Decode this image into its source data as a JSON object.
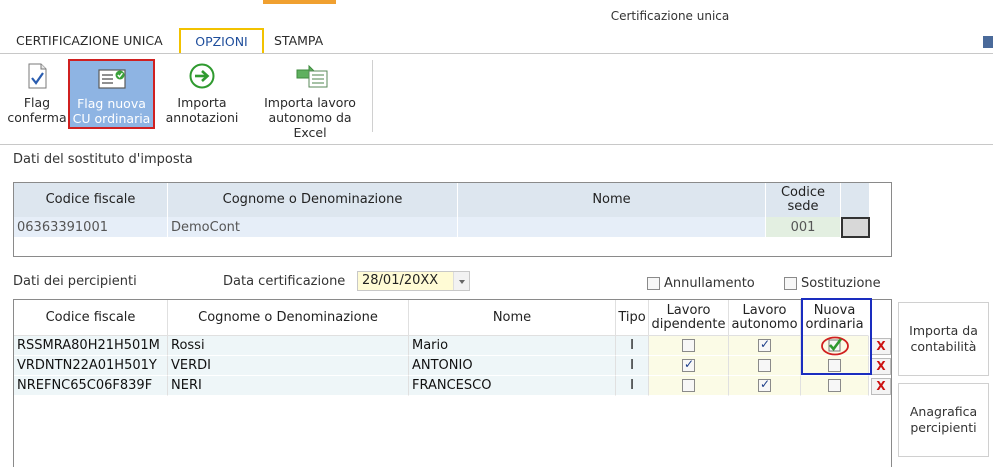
{
  "window": {
    "title": "Certificazione unica"
  },
  "ribbon": {
    "tabs": [
      {
        "label": "CERTIFICAZIONE UNICA"
      },
      {
        "label": "OPZIONI"
      },
      {
        "label": "STAMPA"
      }
    ],
    "buttons": [
      {
        "label": "Flag\nconferma",
        "icon": "document-check-icon"
      },
      {
        "label": "Flag nuova\nCU ordinaria",
        "icon": "card-check-icon"
      },
      {
        "label": "Importa\nannotazioni",
        "icon": "arrow-right-circle-icon"
      },
      {
        "label": "Importa lavoro\nautonomo da Excel",
        "icon": "excel-import-icon"
      }
    ]
  },
  "sostituto": {
    "section_label": "Dati del sostituto d'imposta",
    "columns": [
      "Codice fiscale",
      "Cognome o Denominazione",
      "Nome",
      "Codice\nsede"
    ],
    "row": {
      "codice_fiscale": "06363391001",
      "denominazione": "DemoCont",
      "nome": "",
      "codice_sede": "001"
    }
  },
  "percipienti": {
    "section_label": "Dati dei percipienti",
    "date_label": "Data certificazione",
    "date_value": "28/01/20XX",
    "annullamento_label": "Annullamento",
    "sostituzione_label": "Sostituzione",
    "columns": [
      "Codice fiscale",
      "Cognome o Denominazione",
      "Nome",
      "Tipo",
      "Lavoro\ndipendente",
      "Lavoro\nautonomo",
      "Nuova\nordinaria"
    ],
    "rows": [
      {
        "codice_fiscale": "RSSMRA80H21H501M",
        "cognome": "Rossi",
        "nome": "Mario",
        "tipo": "I",
        "dipendente": false,
        "autonomo": true,
        "nuova": true
      },
      {
        "codice_fiscale": "VRDNTN22A01H501Y",
        "cognome": "VERDI",
        "nome": "ANTONIO",
        "tipo": "I",
        "dipendente": true,
        "autonomo": false,
        "nuova": false
      },
      {
        "codice_fiscale": "NREFNC65C06F839F",
        "cognome": "NERI",
        "nome": "FRANCESCO",
        "tipo": "I",
        "dipendente": false,
        "autonomo": true,
        "nuova": false
      }
    ],
    "delete_label": "X"
  },
  "side_buttons": {
    "importa": "Importa da\ncontabilità",
    "anagrafica": "Anagrafica\npercipienti"
  },
  "colors": {
    "accent": "#f0a030",
    "highlight_blue": "#1a2dbf",
    "highlight_red": "#d02020",
    "selected_button": "#8eb4e3"
  }
}
